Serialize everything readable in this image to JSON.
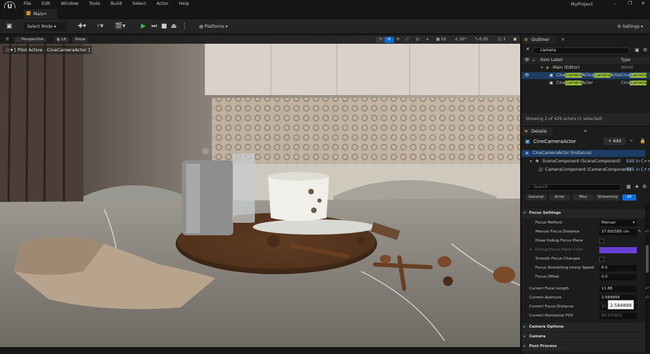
{
  "menubar": {
    "items": [
      "File",
      "Edit",
      "Window",
      "Tools",
      "Build",
      "Select",
      "Actor",
      "Help"
    ],
    "project": "MyProject"
  },
  "tabs": {
    "main": "Main•"
  },
  "toolbar": {
    "select_mode": "Select Mode",
    "platforms": "Platforms",
    "settings": "Settings"
  },
  "viewport": {
    "perspective": "Perspective",
    "lit": "Lit",
    "show": "Show",
    "pilot": "[ Pilot Active - CineCameraActor ]",
    "grid_snap": "10",
    "rot_snap": "10°",
    "scale_snap": "0.25",
    "cam_speed": "1"
  },
  "outliner": {
    "tab": "Outliner",
    "search": "camera",
    "col_label": "Item Label",
    "col_type": "Type",
    "col_world": "World",
    "rows": [
      {
        "pre": "Main (Editor)",
        "hl": "",
        "post": "",
        "type": "World"
      },
      {
        "pre": "Cine",
        "hl": "Camera",
        "post": "ACine",
        "hl2": "Camera",
        "post2": "Actor",
        "type": "Cine",
        "type_hl": "Camera",
        "type_post": "Actor"
      },
      {
        "pre": "Cine",
        "hl": "Camera",
        "post": "Actor",
        "hl2": "",
        "post2": "",
        "type": "Cine",
        "type_hl": "Camera",
        "type_post": "Actor"
      }
    ],
    "status": "Showing 2 of 429 actors (1 selected)"
  },
  "details": {
    "tab": "Details",
    "actor_name": "CineCameraActor",
    "add": "+ Add",
    "instance": "CineCameraActor (Instance)",
    "components": [
      {
        "name": "SceneComponent (SceneComponent)",
        "link": "Edit in C++"
      },
      {
        "name": "CameraComponent (CameraComponent)",
        "link": "Edit in C++"
      }
    ],
    "search_placeholder": "Search",
    "filters": [
      "General",
      "Actor",
      "Misc",
      "Streaming",
      "All"
    ],
    "props": [
      {
        "label": "Focus Settings",
        "value": "",
        "cat": true
      },
      {
        "label": "Focus Method",
        "value": "Manual"
      },
      {
        "label": "Manual Focus Distance",
        "value": "37.692585 cm"
      },
      {
        "label": "Draw Debug Focus Plane",
        "value": ""
      },
      {
        "label": "Debug Focus Plane Color",
        "value": ""
      },
      {
        "label": "Smooth Focus Changes",
        "value": ""
      },
      {
        "label": "Focus Smoothing Interp Speed",
        "value": "8.0"
      },
      {
        "label": "Focus Offset",
        "value": "0.0"
      },
      {
        "label": "Current Focal Length",
        "value": "11.88"
      },
      {
        "label": "Current Aperture",
        "value": "2.584899"
      },
      {
        "label": "Current Focus Distance",
        "value": "37.6"
      },
      {
        "label": "Current Horizontal FOV",
        "value": "90.575821"
      }
    ],
    "sections": [
      "Camera Options",
      "Camera",
      "Post Process"
    ],
    "tooltip": "2.584899"
  },
  "colors": {
    "accent": "#0a6cd6",
    "highlight": "#9ec23a",
    "debug_color": "#6a3fd4"
  }
}
